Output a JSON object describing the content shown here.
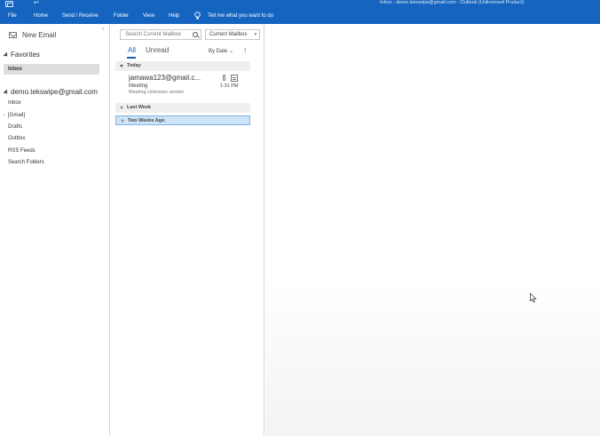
{
  "titlebar": {
    "quick_access": "↩",
    "window_title": "Inbox - demo.tekswipe@gmail.com - Outlook (Unlicensed Product)"
  },
  "ribbon": {
    "tabs": [
      "File",
      "Home",
      "Send / Receive",
      "Folder",
      "View",
      "Help"
    ],
    "tell_me": "Tell me what you want to do"
  },
  "folder_pane": {
    "new_email": "New Email",
    "favorites_label": "Favorites",
    "favorites_inbox": "Inbox",
    "account": "demo.tekswipe@gmail.com",
    "folders": [
      "Inbox",
      "[Gmail]",
      "Drafts",
      "Outbox",
      "RSS Feeds",
      "Search Folders"
    ]
  },
  "message_list": {
    "search_placeholder": "Search Current Mailbox",
    "scope": "Current Mailbox",
    "filter_all": "All",
    "filter_unread": "Unread",
    "sort_by": "By Date",
    "sort_direction": "↑",
    "groups": {
      "today": "Today",
      "last_week": "Last Week",
      "two_weeks_ago": "Two Weeks Ago"
    },
    "items": [
      {
        "sender": "jamawa123@gmail.c...",
        "subject": "Meeting",
        "preview": "Meeting  Unknown sender",
        "time": "1:31 PM"
      }
    ]
  },
  "colors": {
    "accent": "#1565c0",
    "selection": "#cde3f7"
  }
}
